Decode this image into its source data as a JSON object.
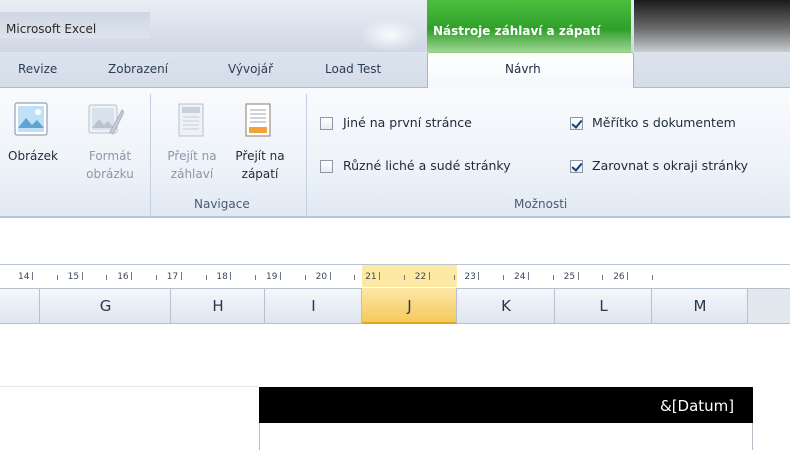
{
  "window": {
    "app_title": "Microsoft Excel",
    "context_tab_title": "Nástroje záhlaví a zápatí"
  },
  "tabs": [
    {
      "label": "Revize"
    },
    {
      "label": "Zobrazení"
    },
    {
      "label": "Vývojář"
    },
    {
      "label": "Load Test"
    },
    {
      "label": "Návrh",
      "active": true
    }
  ],
  "ribbon": {
    "picture_group": {
      "obrazek_label": "Obrázek",
      "format_label_1": "Formát",
      "format_label_2": "obrázku"
    },
    "navigation": {
      "goto_header_1": "Přejít na",
      "goto_header_2": "záhlaví",
      "goto_footer_1": "Přejít na",
      "goto_footer_2": "zápatí",
      "group_label": "Navigace"
    },
    "options": {
      "group_label": "Možnosti",
      "checkboxes": [
        {
          "label": "Jiné na první stránce",
          "checked": false
        },
        {
          "label": "Různé liché a sudé stránky",
          "checked": false
        },
        {
          "label": "Měřítko s dokumentem",
          "checked": true
        },
        {
          "label": "Zarovnat s okraji stránky",
          "checked": true
        }
      ]
    }
  },
  "ruler": {
    "numbers": [
      "14",
      "15",
      "16",
      "17",
      "18",
      "19",
      "20",
      "21",
      "22",
      "23",
      "24",
      "25",
      "26"
    ]
  },
  "columns": [
    {
      "label": "G"
    },
    {
      "label": "H"
    },
    {
      "label": "I"
    },
    {
      "label": "J",
      "selected": true
    },
    {
      "label": "K"
    },
    {
      "label": "L"
    },
    {
      "label": "M"
    }
  ],
  "page": {
    "header_right_text": "&[Datum]"
  },
  "colors": {
    "context_green": "#2f9f2a",
    "selected_column": "#f6c95b",
    "header_bg": "#000000"
  }
}
